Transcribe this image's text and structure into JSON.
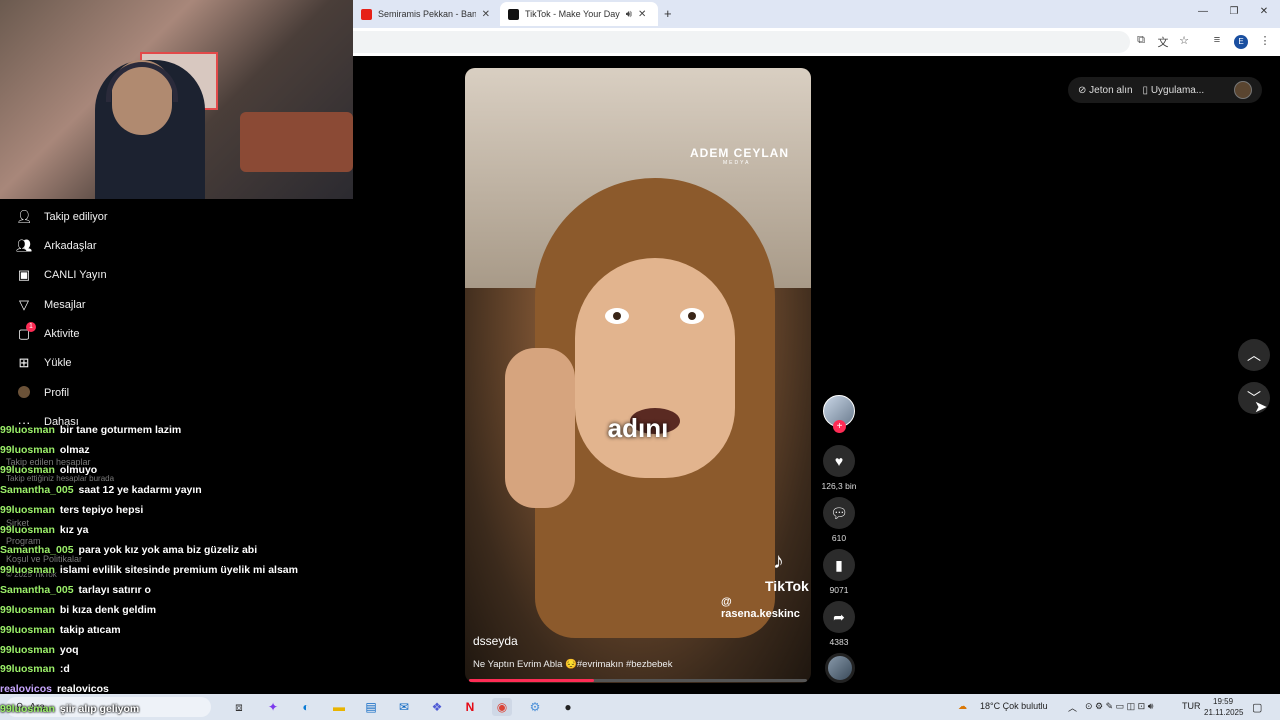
{
  "browser": {
    "tabs": [
      {
        "title": "Semiramis Pekkan - Bana Yalan",
        "active": false
      },
      {
        "title": "TikTok - Make Your Day",
        "active": true
      }
    ],
    "new_tab_symbol": "+",
    "window_controls": [
      "minimize-icon",
      "restore-icon",
      "close-icon"
    ],
    "profile_initial": "E"
  },
  "sidebar": {
    "items": [
      {
        "label": "Takip ediliyor",
        "icon": "person-icon"
      },
      {
        "label": "Arkadaşlar",
        "icon": "friends-icon"
      },
      {
        "label": "CANLI Yayın",
        "icon": "live-icon"
      },
      {
        "label": "Mesajlar",
        "icon": "send-icon"
      },
      {
        "label": "Aktivite",
        "icon": "inbox-icon",
        "badge": "1"
      },
      {
        "label": "Yükle",
        "icon": "upload-icon"
      },
      {
        "label": "Profil",
        "icon": "profile-avatar-icon"
      },
      {
        "label": "Dahası",
        "icon": "more-icon"
      }
    ],
    "following_heading": "Takip edilen hesaplar",
    "following_hint": "Takip ettiğiniz hesaplar burada",
    "footer": [
      "Şirket",
      "Program",
      "Koşul ve Politikalar",
      "© 2025 TikTok"
    ]
  },
  "chat": [
    {
      "user": "99luosman",
      "msg": "bir tane goturmem lazim",
      "color": "#9cf06a"
    },
    {
      "user": "99luosman",
      "msg": "olmaz",
      "color": "#9cf06a"
    },
    {
      "user": "99luosman",
      "msg": "olmuyo",
      "color": "#9cf06a"
    },
    {
      "user": "Samantha_005",
      "msg": "saat 12 ye kadarmı yayın",
      "color": "#9cf06a"
    },
    {
      "user": "99luosman",
      "msg": "ters tepiyo hepsi",
      "color": "#9cf06a"
    },
    {
      "user": "99luosman",
      "msg": "kız ya",
      "color": "#9cf06a"
    },
    {
      "user": "Samantha_005",
      "msg": "para yok kız yok ama biz güzeliz abi",
      "color": "#9cf06a"
    },
    {
      "user": "99luosman",
      "msg": "islami evlilik sitesinde premium üyelik mi alsam",
      "color": "#9cf06a"
    },
    {
      "user": "Samantha_005",
      "msg": "tarlayı satırır o",
      "color": "#9cf06a"
    },
    {
      "user": "99luosman",
      "msg": "bi kıza denk geldim",
      "color": "#9cf06a"
    },
    {
      "user": "99luosman",
      "msg": "takip atıcam",
      "color": "#9cf06a"
    },
    {
      "user": "99luosman",
      "msg": "yoq",
      "color": "#9cf06a"
    },
    {
      "user": "99luosman",
      "msg": ":d",
      "color": "#9cf06a"
    },
    {
      "user": "realovicos",
      "msg": "realovicos",
      "color": "#c9a7ff"
    },
    {
      "user": "99luosman",
      "msg": "şiir alıp geliyom",
      "color": "#9cf06a"
    }
  ],
  "video": {
    "watermark_brand": "ADEM CEYLAN",
    "watermark_sub": "MEDYA",
    "caption": "adını",
    "tiktok_word": "TikTok",
    "tiktok_user": "@ rasena.keskinc",
    "author": "dsseyda",
    "description": "Ne Yaptın Evrim Abla 😔#evrimakın #bezbebek",
    "progress": 0.37
  },
  "actions": {
    "likes": "126,3 bin",
    "comments": "610",
    "saves": "9071",
    "shares": "4383"
  },
  "topright": {
    "coins_label": "Jeton alın",
    "app_label": "Uygulama..."
  },
  "taskbar": {
    "search_label": "Ara",
    "weather": "18°C  Çok bulutlu",
    "lang": "TUR",
    "time": "19:59",
    "date": "21.11.2025",
    "apps": [
      "task-view-icon",
      "copilot-icon",
      "edge-icon",
      "file-explorer-icon",
      "store-icon",
      "outlook-icon",
      "teams-icon",
      "netflix-icon",
      "chrome-icon",
      "settings-icon",
      "obs-icon"
    ]
  },
  "colors": {
    "accent": "#fe2c55",
    "chat_user": "#9cf06a"
  }
}
